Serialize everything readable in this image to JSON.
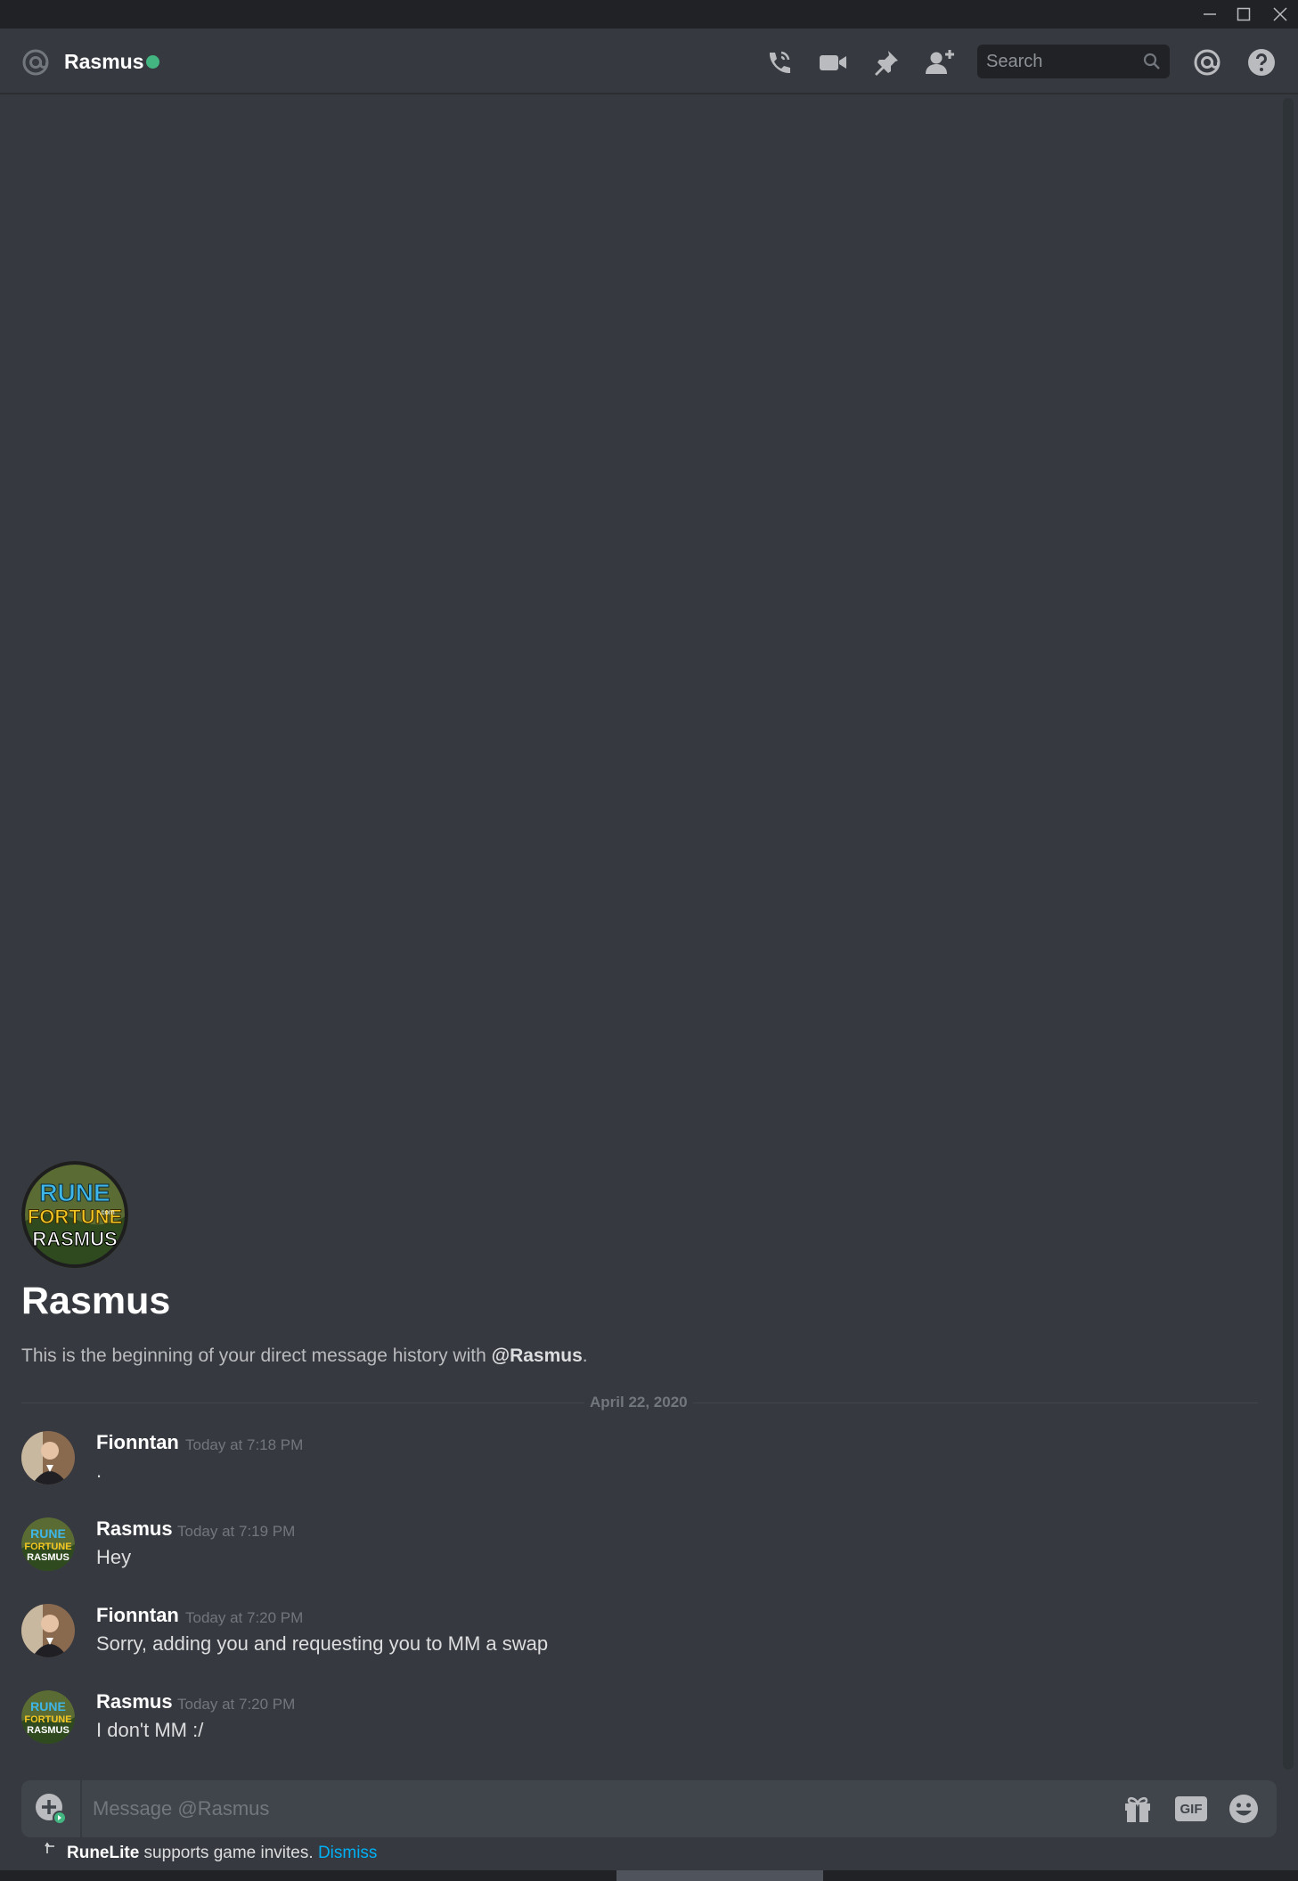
{
  "window": {
    "controls": [
      "minimize-icon",
      "maximize-icon",
      "close-icon"
    ]
  },
  "header": {
    "at_icon": "at-icon",
    "username": "Rasmus",
    "status": "online",
    "status_color": "#43b581",
    "icons": [
      "voice-call-icon",
      "video-call-icon",
      "pin-icon",
      "add-friend-icon"
    ],
    "search_placeholder": "Search",
    "right_icons": [
      "mentions-icon",
      "help-icon"
    ]
  },
  "intro": {
    "avatar_text": [
      "RUNE",
      "FORTUNE",
      "RASMUS"
    ],
    "avatar_subtext": ".com",
    "name": "Rasmus",
    "description_prefix": "This is the beginning of your direct message history with ",
    "description_mention": "@Rasmus",
    "description_suffix": "."
  },
  "date_divider": "April 22, 2020",
  "messages": [
    {
      "author": "Fionntan",
      "timestamp": "Today at 7:18 PM",
      "content": "."
    },
    {
      "author": "Rasmus",
      "timestamp": "Today at 7:19 PM",
      "content": "Hey"
    },
    {
      "author": "Fionntan",
      "timestamp": "Today at 7:20 PM",
      "content": "Sorry, adding you and requesting you to MM a swap"
    },
    {
      "author": "Rasmus",
      "timestamp": "Today at 7:20 PM",
      "content": "I don't MM :/"
    }
  ],
  "composer": {
    "placeholder": "Message @Rasmus",
    "gif_label": "GIF",
    "icons": [
      "upload-icon",
      "gift-icon",
      "gif-icon",
      "emoji-icon"
    ]
  },
  "notice": {
    "app": "RuneLite",
    "text": " supports game invites. ",
    "link": "Dismiss"
  },
  "colors": {
    "background": "#36393f",
    "titlebar": "#202225",
    "accent_link": "#00b0f4",
    "online": "#43b581"
  }
}
